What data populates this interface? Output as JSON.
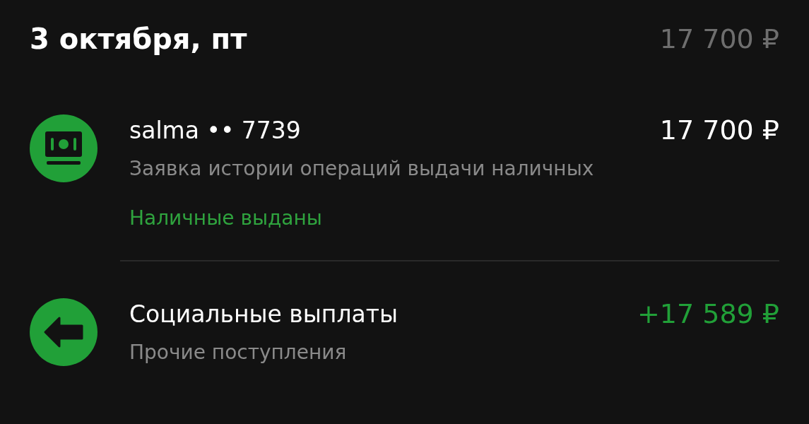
{
  "day": {
    "date": "3 октября, пт",
    "total": "17 700 ₽"
  },
  "operations": [
    {
      "kind": "cash",
      "title": "salma •• 7739",
      "amount": "17 700 ₽",
      "description": "Заявка истории операций выдачи наличных",
      "status": "Наличные выданы"
    },
    {
      "kind": "income",
      "title": "Социальные выплаты",
      "amount": "+17 589 ₽",
      "description": "Прочие поступления"
    }
  ]
}
